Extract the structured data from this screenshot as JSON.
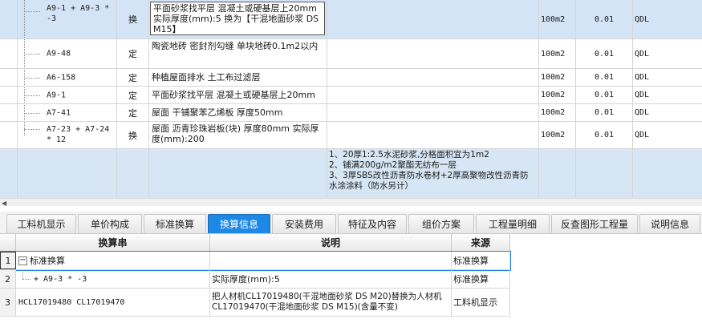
{
  "upper_rows": [
    {
      "code": "A9-1 + A9-3 * -3",
      "type": "换",
      "desc": "平面砂浆找平层 混凝土或硬基层上20mm  实际厚度(mm):5  换为【干混地面砂浆 DS M15】",
      "unit": "100m2",
      "qty": "0.01",
      "source": "QDL"
    },
    {
      "code": "A9-48",
      "type": "定",
      "desc": "陶瓷地砖 密封剂勾缝 单块地砖0.1m2以内",
      "unit": "100m2",
      "qty": "0.01",
      "source": "QDL"
    },
    {
      "code": "A6-158",
      "type": "定",
      "desc": "种植屋面排水 土工布过滤层",
      "unit": "100m2",
      "qty": "0.01",
      "source": "QDL"
    },
    {
      "code": "A9-1",
      "type": "定",
      "desc": "平面砂浆找平层 混凝土或硬基层上20mm",
      "unit": "100m2",
      "qty": "0.01",
      "source": "QDL"
    },
    {
      "code": "A7-41",
      "type": "定",
      "desc": "屋面 干铺聚苯乙烯板 厚度50mm",
      "unit": "100m2",
      "qty": "0.01",
      "source": "QDL"
    },
    {
      "code": "A7-23 + A7-24 * 12",
      "type": "换",
      "desc": "屋面 沥青珍珠岩板(块) 厚度80mm  实际厚度(mm):200",
      "unit": "100m2",
      "qty": "0.01",
      "source": "QDL"
    }
  ],
  "note_lines": [
    "1、20厚1:2.5水泥砂浆,分格面积宜为1m2",
    "2、铺满200g/m2聚酯无纺布一层",
    "3、3厚SBS改性沥青防水卷材+2厚高聚物改性沥青防水涂涂料（防水另计）"
  ],
  "tabs": [
    "工料机显示",
    "单价构成",
    "标准换算",
    "换算信息",
    "安装费用",
    "特征及内容",
    "组价方案",
    "工程量明细",
    "反查图形工程量",
    "说明信息"
  ],
  "active_tab": "换算信息",
  "lower_headers": [
    "换算串",
    "说明",
    "来源"
  ],
  "lower_rows": [
    {
      "num": "1",
      "expander": "−",
      "str": "标准换算",
      "desc": "",
      "source": "标准换算"
    },
    {
      "num": "2",
      "str": "+ A9-3 * -3",
      "desc": "实际厚度(mm):5",
      "source": "标准换算"
    },
    {
      "num": "3",
      "str": "HCL17019480 CL17019470",
      "desc": "把人材机CL17019480(干混地面砂浆 DS M20)替换为人材机CL17019470(干混地面砂浆 DS M15)(含量不变)",
      "source": "工料机显示"
    }
  ],
  "colors": {
    "selected_row": "#d4e4f7",
    "note_row": "#d6e6f4",
    "active_tab": "#1e88e5"
  }
}
